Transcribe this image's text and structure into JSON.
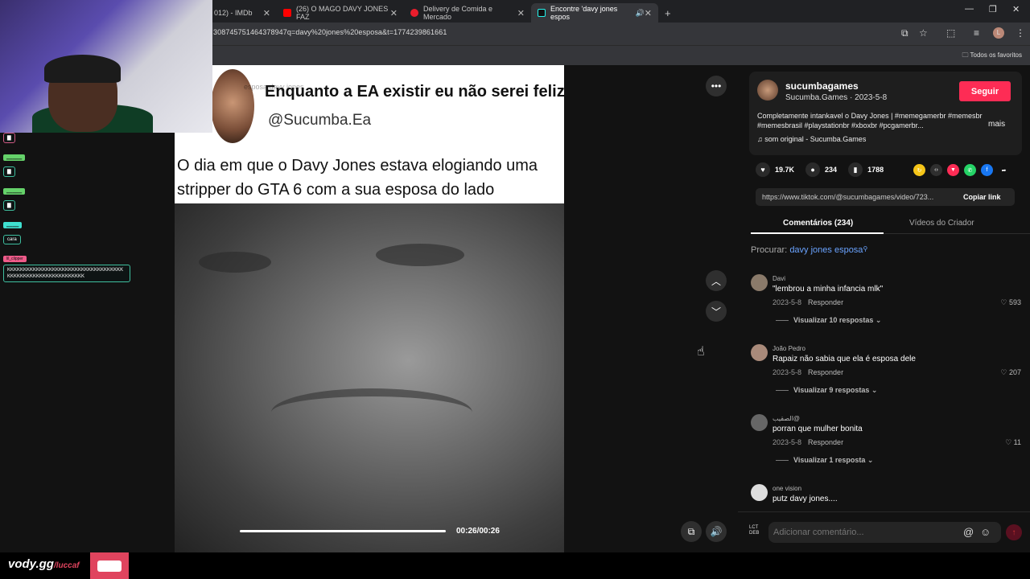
{
  "browser": {
    "tabs": [
      {
        "title": "012) - IMDb",
        "favicon_color": "#f5c518"
      },
      {
        "title": "(26) O MAGO DAVY JONES FAZ",
        "favicon_color": "#ff0000"
      },
      {
        "title": "Delivery de Comida e Mercado",
        "favicon_color": "#ea1d2c"
      },
      {
        "title": "Encontre 'davy jones espos",
        "favicon_color": "#25f4ee"
      }
    ],
    "new_tab": "+",
    "url": "308745751464378947q=davy%20jones%20esposa&t=1774239861661",
    "bookmarks_all": "Todos os favoritos",
    "profile_initial": "L"
  },
  "stream_chat": {
    "messages": [
      {
        "user": "",
        "text": "▇",
        "color": "#d25a84"
      },
      {
        "user": "▁▁▁▁▁",
        "text": "▇",
        "color": "#65d26a"
      },
      {
        "user": "▁▁▁▁▁",
        "text": "▇",
        "color": "#65d26a"
      },
      {
        "user": "▁▁▁▁",
        "text": "cara",
        "color": "#3fe0d0"
      },
      {
        "user": "lil_clipper",
        "text": "KKKKKKKKKKKKKKKKKKKKKKKKKKKKKKKKKKKKKKKKKKKKKKKKKKKKKKKKKKKK",
        "color": "#ef5b8a"
      }
    ]
  },
  "video": {
    "tweet_line1": "Enquanto a EA existir eu não serei feliz",
    "tweet_handle": "@Sucumba.Ea",
    "tweet_search_ghost": "esposa davy jones",
    "caption": "O dia em que o Davy Jones estava elogiando uma stripper do GTA 6 com a sua esposa do lado",
    "time": "00:26/00:26",
    "progress": 1.0
  },
  "author": {
    "username": "sucumbagames",
    "display_name": "Sucumba.Games · 2023-5-8",
    "follow_label": "Seguir",
    "description": "Completamente intankavel o Davy Jones | #memegamerbr #memesbr #memesbrasil #playstationbr #xboxbr #pcgamerbr...",
    "more_label": "mais",
    "music": "som original - Sucumba.Games"
  },
  "stats": {
    "likes": "19.7K",
    "comments": "234",
    "saves": "1788"
  },
  "share_link": {
    "url": "https://www.tiktok.com/@sucumbagames/video/723...",
    "copy_label": "Copiar link"
  },
  "tabs": {
    "comments": "Comentários (234)",
    "creator_videos": "Vídeos do Criador"
  },
  "search": {
    "label": "Procurar:",
    "query": "davy jones esposa"
  },
  "comments": [
    {
      "user": "Davi",
      "text": "\"lembrou a minha infancia mlk\"",
      "date": "2023-5-8",
      "reply": "Responder",
      "likes": "593",
      "replies": "Visualizar 10 respostas ⌄",
      "avatar": "#8a7a6a"
    },
    {
      "user": "João Pedro",
      "text": "Rapaiz não sabia que ela é esposa dele",
      "date": "2023-5-8",
      "reply": "Responder",
      "likes": "207",
      "replies": "Visualizar 9 respostas ⌄",
      "avatar": "#a98a7a"
    },
    {
      "user": "الصقيب@",
      "text": "porran que mulher bonita",
      "date": "2023-5-8",
      "reply": "Responder",
      "likes": "11",
      "replies": "Visualizar 1 resposta ⌄",
      "avatar": "#666"
    },
    {
      "user": "one vision",
      "text": "putz davy jones....",
      "date": "",
      "reply": "",
      "likes": "",
      "replies": "",
      "avatar": "#ddd"
    }
  ],
  "compose": {
    "placeholder": "Adicionar comentário...",
    "logo_text": "LCT DEB"
  },
  "footer": {
    "brand": "vody.gg",
    "brand_suffix": "/luccaf"
  },
  "colors": {
    "accent": "#fe2c55",
    "link": "#6aa3ff"
  }
}
